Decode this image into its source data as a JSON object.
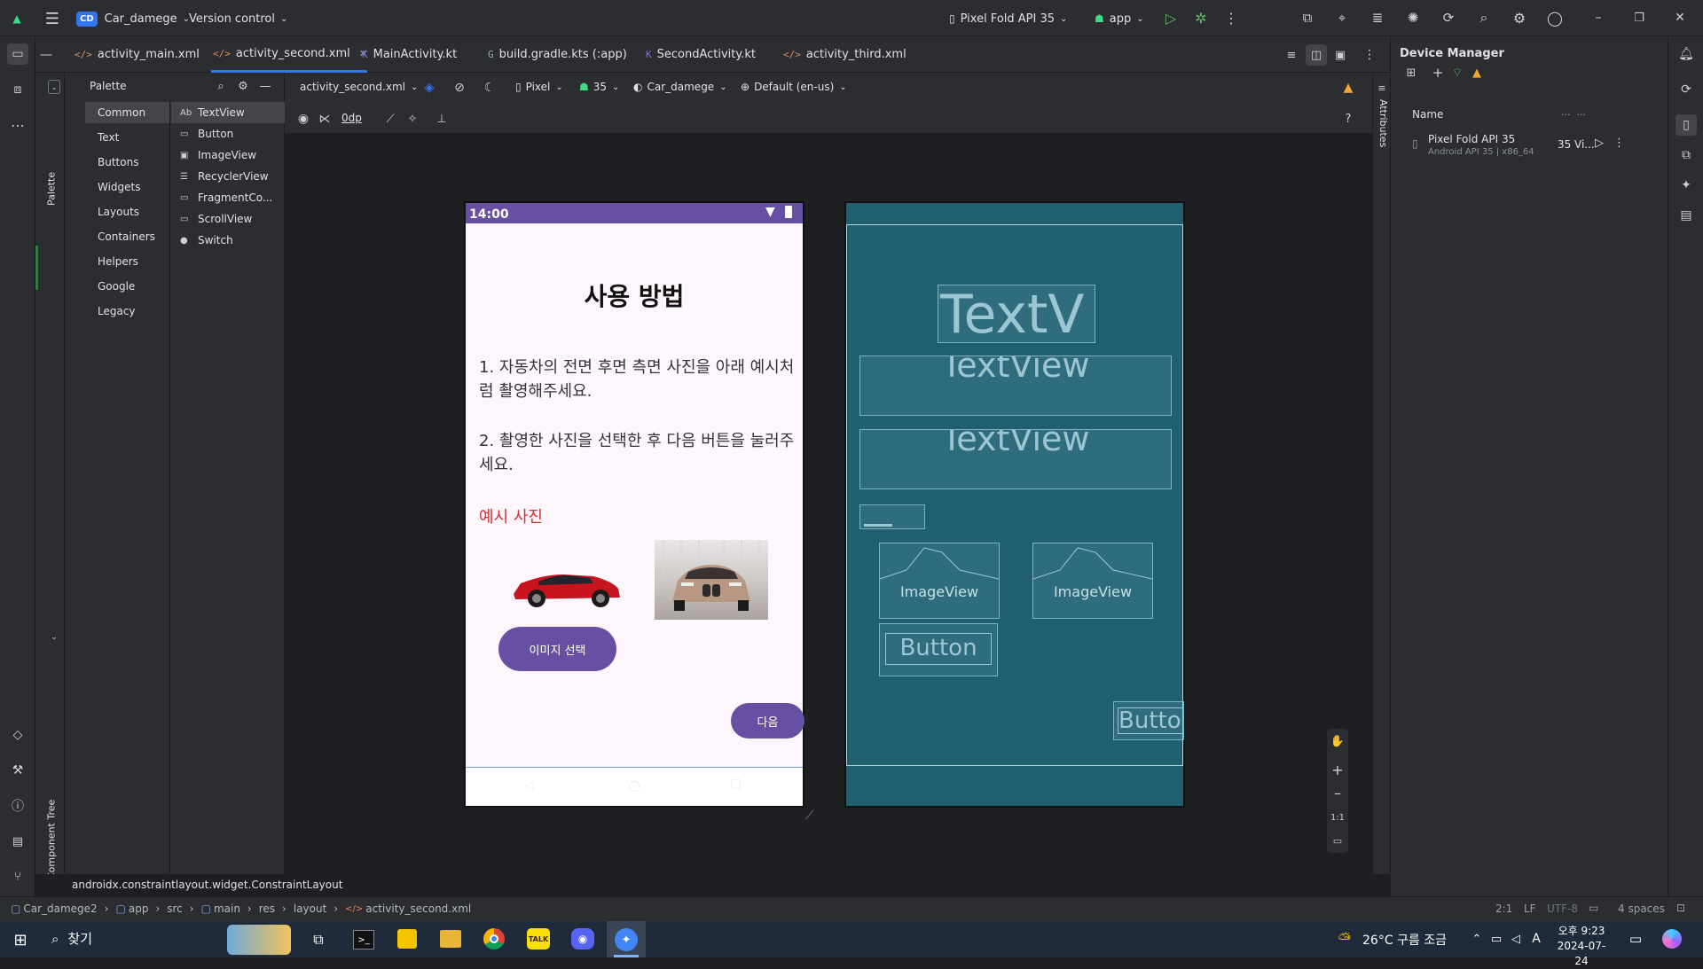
{
  "titlebar": {
    "project_badge": "CD",
    "project": "Car_damege",
    "vcs": "Version control",
    "device": "Pixel Fold API 35",
    "run_config": "app"
  },
  "tabs": [
    {
      "label": "activity_main.xml",
      "icon": "</>"
    },
    {
      "label": "activity_second.xml",
      "icon": "</>"
    },
    {
      "label": "MainActivity.kt",
      "icon": "K"
    },
    {
      "label": "build.gradle.kts (:app)",
      "icon": "G"
    },
    {
      "label": "SecondActivity.kt",
      "icon": "K"
    },
    {
      "label": "activity_third.xml",
      "icon": "</>"
    }
  ],
  "palette": {
    "title": "Palette",
    "categories": [
      "Common",
      "Text",
      "Buttons",
      "Widgets",
      "Layouts",
      "Containers",
      "Helpers",
      "Google",
      "Legacy"
    ],
    "items": [
      {
        "glyph": "Ab",
        "label": "TextView"
      },
      {
        "glyph": "▭",
        "label": "Button"
      },
      {
        "glyph": "▣",
        "label": "ImageView"
      },
      {
        "glyph": "☰",
        "label": "RecyclerView"
      },
      {
        "glyph": "▭",
        "label": "FragmentCo..."
      },
      {
        "glyph": "▭",
        "label": "ScrollView"
      },
      {
        "glyph": "●",
        "label": "Switch"
      }
    ],
    "strip_palette": "Palette",
    "strip_tree": "Component Tree"
  },
  "design_toolbar": {
    "file": "activity_second.xml",
    "device": "Pixel",
    "api": "35",
    "theme": "Car_damege",
    "locale": "Default (en-us)",
    "margin": "0dp"
  },
  "phone": {
    "time": "14:00",
    "title": "사용 방법",
    "step1": "1. 자동차의 전면 후면 측면 사진을 아래 예시처럼 촬영해주세요.",
    "step2": "2. 촬영한 사진을 선택한 후 다음 버튼을 눌러주세요.",
    "example": "예시 사진",
    "select_button": "이미지 선택",
    "next_button": "다음",
    "accent": "#6750a4",
    "example_color": "#d32f2f"
  },
  "blueprint": {
    "tv1": "TextV",
    "tv2": "TextView",
    "tv3": "TextView",
    "img1": "ImageView",
    "img2": "ImageView",
    "btn1": "Button",
    "btn2": "Button"
  },
  "zoom": {
    "ratio": "1:1"
  },
  "device_manager": {
    "title": "Device Manager",
    "col_name": "Name",
    "device": "Pixel Fold API 35",
    "device_sub": "Android API 35 | x86_64",
    "api": "35",
    "vi": "Vi..."
  },
  "attributes_label": "Attributes",
  "status": {
    "component": "androidx.constraintlayout.widget.ConstraintLayout"
  },
  "breadcrumb": [
    "Car_damege2",
    "app",
    "src",
    "main",
    "res",
    "layout",
    "activity_second.xml"
  ],
  "navbar_right": {
    "pos": "2:1",
    "lf": "LF",
    "enc": "UTF-8",
    "indent": "4 spaces"
  },
  "taskbar": {
    "search": "찾기",
    "weather": "26°C 구름 조금",
    "time": "오후 9:23",
    "date": "2024-07-24",
    "ime": "A"
  }
}
